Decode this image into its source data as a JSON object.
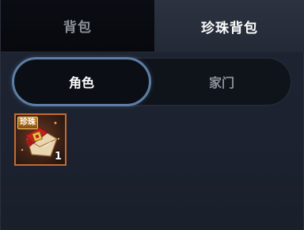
{
  "top_tabs": [
    {
      "label": "背包",
      "active": false
    },
    {
      "label": "珍珠背包",
      "active": true
    }
  ],
  "sub_tabs": [
    {
      "label": "角色",
      "active": true
    },
    {
      "label": "家门",
      "active": false
    }
  ],
  "items": [
    {
      "tag": "珍珠",
      "count": "1",
      "icon": "red-envelope-pouch-icon"
    }
  ],
  "colors": {
    "slot_border": "#c76a2e",
    "active_subtab_border": "#5d7ea4",
    "panel_bg": "#1e2430"
  }
}
